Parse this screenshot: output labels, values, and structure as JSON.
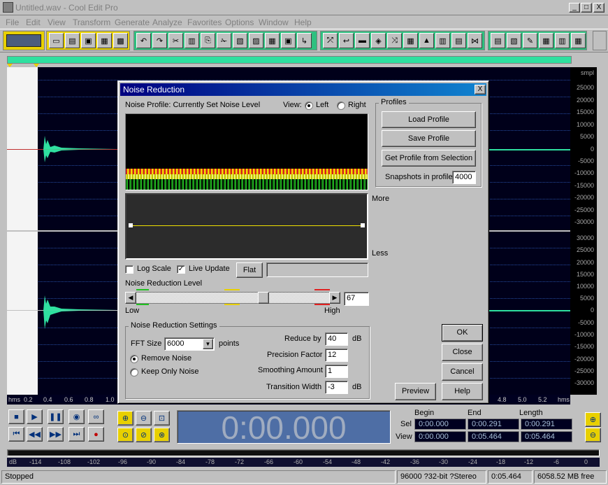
{
  "window": {
    "title": "Untitled.wav - Cool Edit Pro",
    "min": "_",
    "max": "□",
    "close": "X"
  },
  "menu": [
    "File",
    "Edit",
    "View",
    "Transform",
    "Generate",
    "Analyze",
    "Favorites",
    "Options",
    "Window",
    "Help"
  ],
  "scale": {
    "unit": "smpl",
    "top": [
      "25000",
      "20000",
      "15000",
      "10000",
      "5000",
      "0",
      "-5000",
      "-10000",
      "-15000",
      "-20000",
      "-25000",
      "-30000"
    ],
    "bottom": [
      "30000",
      "25000",
      "20000",
      "15000",
      "10000",
      "5000",
      "0",
      "-5000",
      "-10000",
      "-15000",
      "-20000",
      "-25000",
      "-30000"
    ]
  },
  "timeline": {
    "left_label": "hms",
    "left_ticks": [
      "0.2",
      "0.4",
      "0.6",
      "0.8",
      "1.0"
    ],
    "right_ticks": [
      "4.8",
      "5.0",
      "5.2"
    ],
    "right_label": "hms"
  },
  "transport": {
    "time": "0:00.000"
  },
  "timeinfo": {
    "headers": {
      "begin": "Begin",
      "end": "End",
      "length": "Length"
    },
    "sel_label": "Sel",
    "view_label": "View",
    "sel": {
      "begin": "0:00.000",
      "end": "0:00.291",
      "length": "0:00.291"
    },
    "view": {
      "begin": "0:00.000",
      "end": "0:05.464",
      "length": "0:05.464"
    }
  },
  "meter": {
    "unit": "dB",
    "ticks": [
      "-114",
      "-108",
      "-102",
      "-96",
      "-90",
      "-84",
      "-78",
      "-72",
      "-66",
      "-60",
      "-54",
      "-48",
      "-42",
      "-36",
      "-30",
      "-24",
      "-18",
      "-12",
      "-6",
      "0"
    ]
  },
  "status": {
    "state": "Stopped",
    "format": "96000 ?32-bit ?Stereo",
    "duration": "0:05.464",
    "free": "6058.52 MB free"
  },
  "dialog": {
    "title": "Noise Reduction",
    "close": "X",
    "profile_label": "Noise Profile: Currently Set Noise Level",
    "view_label": "View:",
    "view_left": "Left",
    "view_right": "Right",
    "more": "More",
    "less": "Less",
    "log_scale": "Log Scale",
    "live_update": "Live Update",
    "flat": "Flat",
    "nr_level_label": "Noise Reduction Level",
    "low": "Low",
    "high": "High",
    "nr_level_value": "67",
    "nr_level_fraction": 0.67,
    "profiles": {
      "group": "Profiles",
      "load": "Load Profile",
      "save": "Save Profile",
      "get": "Get Profile from Selection",
      "snapshots_label": "Snapshots in profile",
      "snapshots_value": "4000"
    },
    "settings": {
      "group": "Noise Reduction Settings",
      "fft_label": "FFT Size",
      "fft_value": "6000",
      "fft_unit": "points",
      "remove": "Remove Noise",
      "keep": "Keep Only Noise",
      "reduce_label": "Reduce by",
      "reduce_value": "40",
      "reduce_unit": "dB",
      "precision_label": "Precision Factor",
      "precision_value": "12",
      "smoothing_label": "Smoothing Amount",
      "smoothing_value": "1",
      "transition_label": "Transition Width",
      "transition_value": "-3",
      "transition_unit": "dB"
    },
    "buttons": {
      "ok": "OK",
      "close": "Close",
      "cancel": "Cancel",
      "preview": "Preview",
      "help": "Help"
    }
  }
}
